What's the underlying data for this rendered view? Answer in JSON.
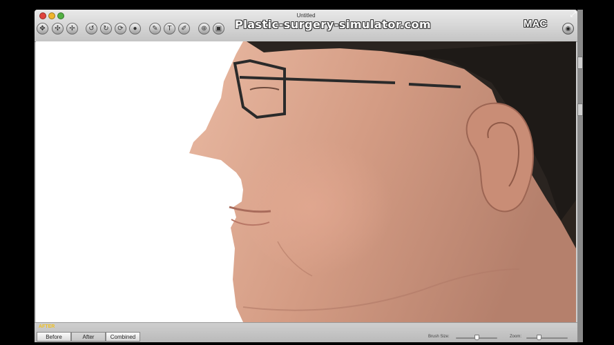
{
  "window": {
    "title": "Untitled"
  },
  "overlay": {
    "watermark": "Plastic-surgery-simulator.com",
    "platform": "MAC"
  },
  "toolbar": {
    "tools": [
      {
        "name": "move-tool",
        "glyph": "✥",
        "active": true
      },
      {
        "name": "expand-tool",
        "glyph": "✣",
        "active": false
      },
      {
        "name": "shrink-tool",
        "glyph": "✢",
        "active": false
      },
      {
        "name": "rotate-left-tool",
        "glyph": "↺",
        "active": false
      },
      {
        "name": "rotate-right-tool",
        "glyph": "↻",
        "active": false
      },
      {
        "name": "twist-tool",
        "glyph": "⟳",
        "active": false
      },
      {
        "name": "smooth-tool",
        "glyph": "●",
        "active": false
      },
      {
        "name": "brush-tool",
        "glyph": "✎",
        "active": true
      },
      {
        "name": "text-tool",
        "glyph": "T",
        "active": false
      },
      {
        "name": "pencil-tool",
        "glyph": "✐",
        "active": false
      },
      {
        "name": "target-tool",
        "glyph": "⊕",
        "active": false
      },
      {
        "name": "camera-tool",
        "glyph": "▣",
        "active": false
      }
    ]
  },
  "bottom": {
    "view_tag": "AFTER",
    "buttons": [
      "Before",
      "After",
      "Combined"
    ],
    "selected": "After",
    "brush_size_label": "Brush Size:",
    "zoom_label": "Zoom:",
    "brush_size_value": 0.5,
    "zoom_value": 0.3
  },
  "colors": {
    "accent": "#2e7d99",
    "after_tag": "#f0c020"
  }
}
